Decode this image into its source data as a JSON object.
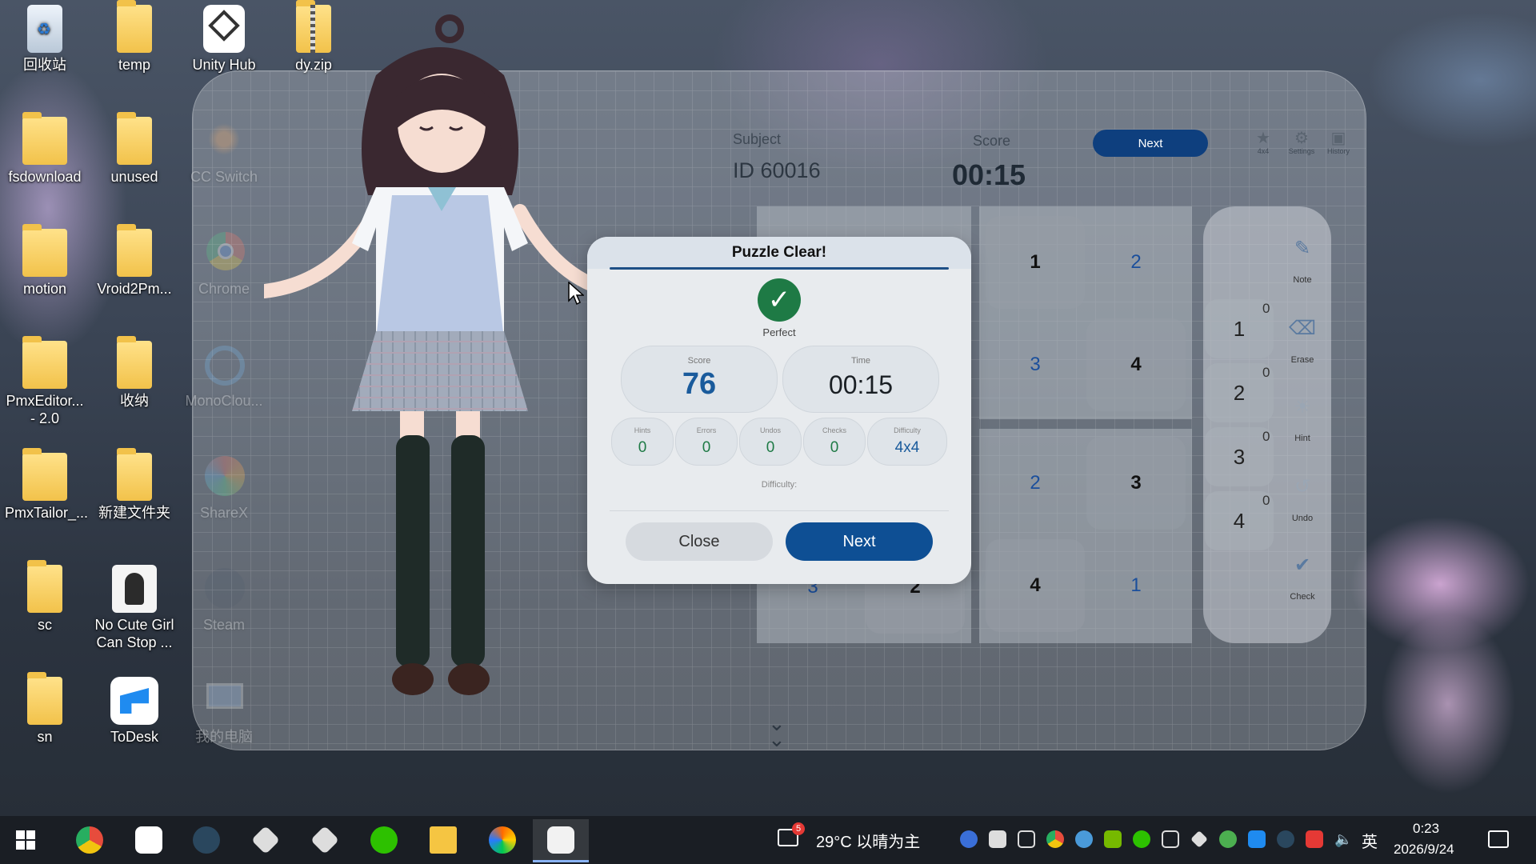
{
  "desktop": {
    "icons": [
      {
        "label": "回收站"
      },
      {
        "label": "temp"
      },
      {
        "label": "Unity Hub"
      },
      {
        "label": "dy.zip"
      },
      {
        "label": "fsdownload"
      },
      {
        "label": "unused"
      },
      {
        "label": "CC Switch"
      },
      {
        "label": "motion"
      },
      {
        "label": "Vroid2Pm..."
      },
      {
        "label": "Chrome"
      },
      {
        "label": "PmxEditor...\n- 2.0"
      },
      {
        "label": "收纳"
      },
      {
        "label": "MonoClou..."
      },
      {
        "label": "PmxTailor_..."
      },
      {
        "label": "新建文件夹"
      },
      {
        "label": "ShareX"
      },
      {
        "label": "sc"
      },
      {
        "label": "No Cute Girl Can Stop ..."
      },
      {
        "label": "Steam"
      },
      {
        "label": "sn"
      },
      {
        "label": "ToDesk"
      },
      {
        "label": "我的电脑"
      }
    ]
  },
  "header": {
    "subject_label": "Subject",
    "subject_value": "ID 60016",
    "score_label": "Score",
    "timer": "00:15",
    "next_label": "Next",
    "tools": [
      {
        "icon": "star-icon",
        "label": "4x4"
      },
      {
        "icon": "gear-icon",
        "label": "Settings"
      },
      {
        "icon": "history-icon",
        "label": "History"
      }
    ]
  },
  "board": {
    "cells": [
      "3",
      "2",
      "1",
      "2",
      "3",
      "4",
      "2",
      "3",
      "4",
      "1"
    ]
  },
  "pad": {
    "numbers": [
      {
        "key": "1",
        "count": "0"
      },
      {
        "key": "2",
        "count": "0"
      },
      {
        "key": "3",
        "count": "0"
      },
      {
        "key": "4",
        "count": "0"
      }
    ],
    "tools": [
      {
        "icon": "note-icon",
        "label": "Note"
      },
      {
        "icon": "eraser-icon",
        "label": "Erase"
      },
      {
        "icon": "lightbulb-icon",
        "label": "Hint"
      },
      {
        "icon": "undo-icon",
        "label": "Undo"
      },
      {
        "icon": "check-circle-icon",
        "label": "Check"
      }
    ]
  },
  "modal": {
    "title": "Puzzle Clear!",
    "status": "Perfect",
    "score_caption": "Score",
    "score_value": "76",
    "time_caption": "Time",
    "time_value": "00:15",
    "stats": [
      {
        "caption": "Hints",
        "value": "0"
      },
      {
        "caption": "Errors",
        "value": "0"
      },
      {
        "caption": "Undos",
        "value": "0"
      },
      {
        "caption": "Checks",
        "value": "0"
      },
      {
        "caption": "Difficulty",
        "value": "4x4"
      }
    ],
    "difficulty_label": "Difficulty:",
    "close_label": "Close",
    "next_label": "Next",
    "accent": "#0e4f94",
    "success": "#1e7a45"
  },
  "taskbar": {
    "weather": "29°C  以晴为主",
    "weather_badge": "5",
    "ime": "英",
    "time": "0:23",
    "date": "2026/9/24"
  }
}
